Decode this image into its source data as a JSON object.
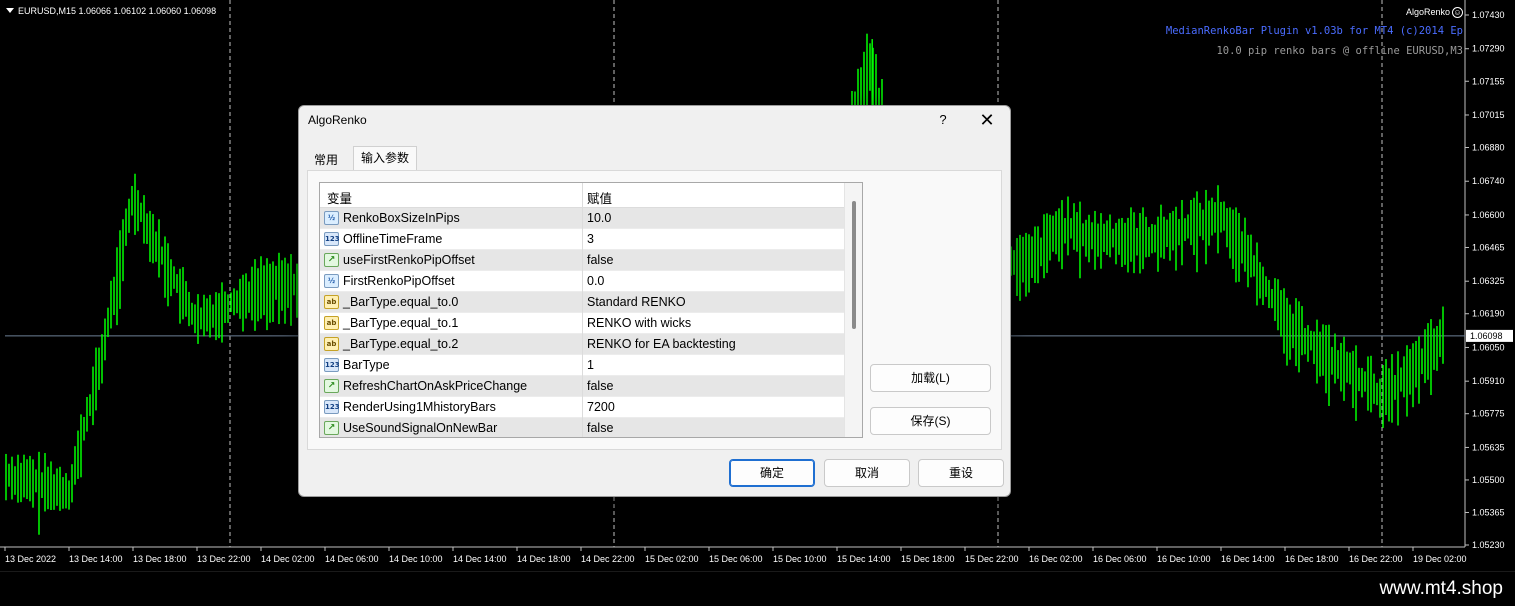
{
  "chart": {
    "symbol_header": "EURUSD,M15  1.06066 1.06102 1.06060 1.06098",
    "ea_badge": "AlgoRenko",
    "ea_badge_icon": "smiley-icon",
    "plugin_line1": "MedianRenkoBar Plugin v1.03b for MT4 (c)2014 Ep",
    "plugin_line2": "10.0 pip renko bars @ offline EURUSD,M3",
    "colors": {
      "background": "#000000",
      "bars": "#00ff00",
      "grid": "#c0c0c0",
      "price_line": "#6e7f96",
      "plugin_link": "#4a6cff"
    },
    "current_price": "1.06098"
  },
  "chart_data": {
    "type": "line",
    "title": "",
    "price_scale": [
      "1.07430",
      "1.07290",
      "1.07155",
      "1.07015",
      "1.06880",
      "1.06740",
      "1.06600",
      "1.06465",
      "1.06325",
      "1.06190",
      "1.06050",
      "1.05910",
      "1.05775",
      "1.05635",
      "1.05500",
      "1.05365",
      "1.05230"
    ],
    "time_scale": [
      "13 Dec 2022",
      "13 Dec 14:00",
      "13 Dec 18:00",
      "13 Dec 22:00",
      "14 Dec 02:00",
      "14 Dec 06:00",
      "14 Dec 10:00",
      "14 Dec 14:00",
      "14 Dec 18:00",
      "14 Dec 22:00",
      "15 Dec 02:00",
      "15 Dec 06:00",
      "15 Dec 10:00",
      "15 Dec 14:00",
      "15 Dec 18:00",
      "15 Dec 22:00",
      "16 Dec 02:00",
      "16 Dec 06:00",
      "16 Dec 10:00",
      "16 Dec 14:00",
      "16 Dec 18:00",
      "16 Dec 22:00",
      "19 Dec 02:00"
    ],
    "ylim": [
      1.0523,
      1.0743
    ],
    "grid": "vertical dashed at day separators",
    "series": [
      {
        "x": [
          0,
          1,
          1.5,
          2,
          2.5,
          3,
          4,
          5,
          6,
          7,
          8,
          8.5,
          9,
          10,
          11,
          12,
          13,
          13.5,
          14,
          15,
          16,
          16.5,
          17,
          18,
          19,
          19.5,
          20,
          21,
          21.5,
          22,
          22.5
        ],
        "values": [
          1.0552,
          1.0545,
          1.06,
          1.0668,
          1.064,
          1.0615,
          1.063,
          1.0632,
          1.0625,
          1.063,
          1.0628,
          1.064,
          1.0625,
          1.0635,
          1.063,
          1.0655,
          1.068,
          1.0725,
          1.067,
          1.064,
          1.064,
          1.0655,
          1.065,
          1.065,
          1.066,
          1.064,
          1.0615,
          1.0595,
          1.0585,
          1.0595,
          1.061
        ]
      }
    ]
  },
  "dialog": {
    "title": "AlgoRenko",
    "help": "?",
    "close": "✕",
    "tabs": [
      "常用",
      "输入参数"
    ],
    "columns": {
      "name": "变量",
      "value": "赋值"
    },
    "params": [
      {
        "icon": "½",
        "type": "frac",
        "name": "RenkoBoxSizeInPips",
        "value": "10.0"
      },
      {
        "icon": "123",
        "type": "int",
        "name": "OfflineTimeFrame",
        "value": "3"
      },
      {
        "icon": "↗",
        "type": "bool",
        "name": "useFirstRenkoPipOffset",
        "value": "false"
      },
      {
        "icon": "½",
        "type": "frac",
        "name": "FirstRenkoPipOffset",
        "value": "0.0"
      },
      {
        "icon": "ab",
        "type": "str",
        "name": "_BarType.equal_to.0",
        "value": "Standard RENKO"
      },
      {
        "icon": "ab",
        "type": "str",
        "name": "_BarType.equal_to.1",
        "value": "RENKO with wicks"
      },
      {
        "icon": "ab",
        "type": "str",
        "name": "_BarType.equal_to.2",
        "value": "RENKO for EA backtesting"
      },
      {
        "icon": "123",
        "type": "int",
        "name": "BarType",
        "value": "1"
      },
      {
        "icon": "↗",
        "type": "bool",
        "name": "RefreshChartOnAskPriceChange",
        "value": "false"
      },
      {
        "icon": "123",
        "type": "int",
        "name": "RenderUsing1MhistoryBars",
        "value": "7200"
      },
      {
        "icon": "↗",
        "type": "bool",
        "name": "UseSoundSignalOnNewBar",
        "value": "false"
      }
    ],
    "buttons": {
      "load": "加载(L)",
      "save": "保存(S)",
      "ok": "确定",
      "cancel": "取消",
      "reset": "重设"
    }
  },
  "watermark": "www.mt4.shop"
}
